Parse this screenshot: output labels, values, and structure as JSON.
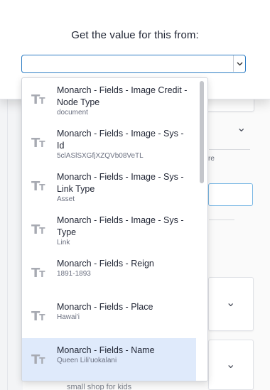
{
  "modal": {
    "title": "Get the value for this from:",
    "select_value": ""
  },
  "options": [
    {
      "title": "Monarch - Fields - Image Credit - Node Type",
      "subtitle": "document",
      "icon": "text-type-icon"
    },
    {
      "title": "Monarch - Fields - Image - Sys - Id",
      "subtitle": "5clASlSXGfjXZQVb08VeTL",
      "icon": "text-type-icon"
    },
    {
      "title": "Monarch - Fields - Image - Sys - Link Type",
      "subtitle": "Asset",
      "icon": "text-type-icon"
    },
    {
      "title": "Monarch - Fields - Image - Sys - Type",
      "subtitle": "Link",
      "icon": "text-type-icon"
    },
    {
      "title": "Monarch - Fields - Reign",
      "subtitle": "1891-1893",
      "icon": "text-type-icon"
    },
    {
      "title": "Monarch - Fields - Place",
      "subtitle": "Hawai'i",
      "icon": "text-type-icon"
    },
    {
      "title": "Monarch - Fields - Name",
      "subtitle": "Queen Lili'uokalani",
      "icon": "text-type-icon",
      "selected": true
    }
  ],
  "background": {
    "partial_text_re": "re",
    "partial_text_bottom": "small shop for kids"
  },
  "colors": {
    "accent": "#2d7dc4",
    "selected_bg": "#dfeafb",
    "icon_gray": "#a7aab2"
  }
}
